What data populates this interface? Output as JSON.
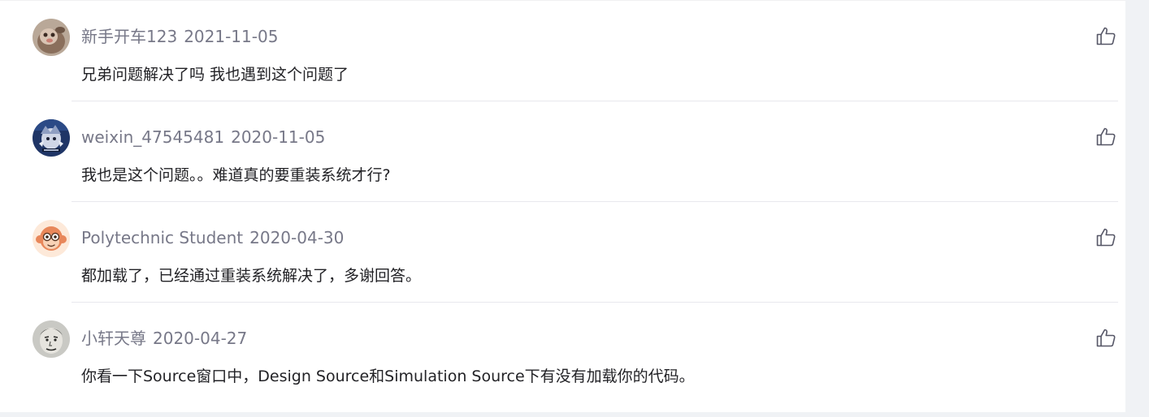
{
  "comments": [
    {
      "username": "新手开车123",
      "date": "2021-11-05",
      "text": "兄弟问题解决了吗 我也遇到这个问题了",
      "avatar_icon": "cartoon-creature-avatar"
    },
    {
      "username": "weixin_47545481",
      "date": "2020-11-05",
      "text": "我也是这个问题。。难道真的要重装系统才行?",
      "avatar_icon": "anime-character-avatar"
    },
    {
      "username": "Polytechnic Student",
      "date": "2020-04-30",
      "text": "都加载了，已经通过重装系统解决了，多谢回答。",
      "avatar_icon": "monkey-avatar"
    },
    {
      "username": "小轩天尊",
      "date": "2020-04-27",
      "text": "你看一下Source窗口中，Design Source和Simulation Source下有没有加载你的代码。",
      "avatar_icon": "sketch-face-avatar"
    }
  ],
  "colors": {
    "username": "#777888",
    "content": "#222226",
    "divider": "#e8e8ed",
    "page_bg": "#f0f2f5"
  },
  "icons": {
    "like": "thumbs-up-icon"
  }
}
